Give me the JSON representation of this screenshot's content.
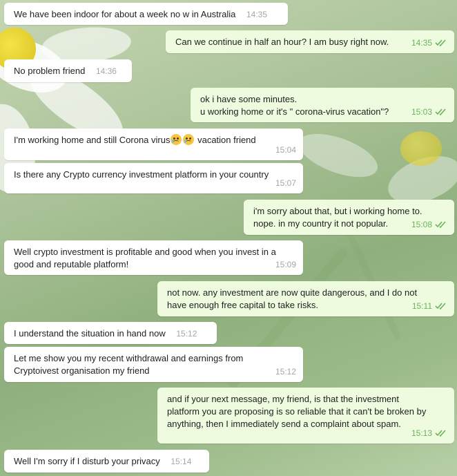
{
  "messages": [
    {
      "dir": "in",
      "text": "We have been indoor for about a week no w in Australia",
      "time": "14:35"
    },
    {
      "dir": "out",
      "text": "Can we continue in half an hour? I am busy right now.",
      "time": "14:35"
    },
    {
      "dir": "in",
      "text": "No problem friend",
      "time": "14:36"
    },
    {
      "dir": "out",
      "text": "ok i have some minutes.\nu working home or it's \" corona-virus vacation\"?",
      "time": "15:03"
    },
    {
      "dir": "in",
      "text_before": "I'm working home and still Corona virus",
      "text_after": "vacation friend",
      "time": "15:04"
    },
    {
      "dir": "in",
      "text": "Is there any Crypto currency investment platform in your country",
      "time": "15:07"
    },
    {
      "dir": "out",
      "text": "i'm sorry about that, but i working home to.\nnope. in my country it not popular.",
      "time": "15:08"
    },
    {
      "dir": "in",
      "text": "Well crypto investment is profitable and good when you invest in a\ngood and reputable platform!",
      "time": "15:09"
    },
    {
      "dir": "out",
      "text": "not now. any investment are now quite dangerous, and I do not\nhave enough free capital to take risks.",
      "time": "15:11"
    },
    {
      "dir": "in",
      "text": "I understand the situation in hand now",
      "time": "15:12"
    },
    {
      "dir": "in",
      "text": "Let me show you my recent withdrawal and earnings from\nCryptoivest organisation my friend",
      "time": "15:12"
    },
    {
      "dir": "out",
      "text": "and if your next message, my friend, is that the investment\nplatform you are proposing is so reliable that it can't be broken by\nanything, then I immediately send a complaint about spam.",
      "time": "15:13"
    },
    {
      "dir": "in",
      "text": "Well I'm sorry if I disturb your privacy",
      "time": "15:14"
    }
  ],
  "icons": {
    "read_receipt": "double-check-icon",
    "emoji": "crying-face-icon"
  },
  "colors": {
    "incoming": "#ffffff",
    "outgoing": "#eefbdf",
    "read_check": "#68b45a",
    "timestamp": "#a6a6a6"
  }
}
